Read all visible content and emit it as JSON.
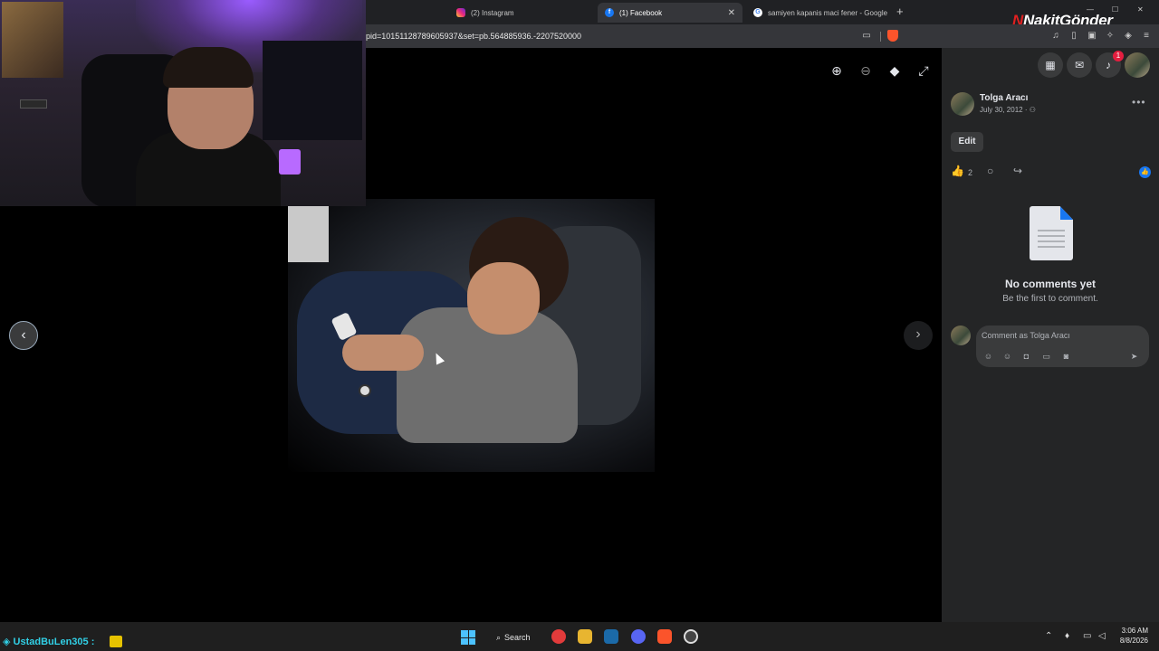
{
  "browser": {
    "tabs": [
      {
        "label": "(2) Instagram",
        "icon": "instagram-icon"
      },
      {
        "label": "(1) Facebook",
        "icon": "facebook-icon",
        "active": true
      },
      {
        "label": "samiyen kapanis maci fener - Google",
        "icon": "google-icon"
      }
    ],
    "new_tab": "+",
    "url": "pid=10151128789605937&set=pb.564885936.-2207520000",
    "brand_overlay": {
      "prefix": "N",
      "text": "NakitGönder"
    }
  },
  "viewer": {
    "tools": [
      "zoom-in-icon",
      "zoom-out-icon",
      "tag-icon",
      "fullscreen-icon"
    ],
    "prev_label": "‹",
    "next_label": "›"
  },
  "panel": {
    "top_buttons": [
      "apps-grid-icon",
      "messenger-icon",
      "notifications-icon",
      "account-avatar"
    ],
    "notification_count": "1",
    "post": {
      "author": "Tolga Aracı",
      "date": "July 30, 2012 ·",
      "privacy_icon": "friends-icon",
      "edit_label": "Edit",
      "like_count": "2"
    },
    "comments": {
      "empty_title": "No comments yet",
      "empty_subtitle": "Be the first to comment.",
      "input_placeholder": "Comment as Tolga Aracı"
    }
  },
  "overlay": {
    "chat_user": "UstadBuLen305 :"
  },
  "taskbar": {
    "search_label": "Search",
    "time": "3:06 AM",
    "date": "8/8/2026"
  },
  "colors": {
    "facebook_blue": "#1877f2",
    "panel_bg": "#242526",
    "chat_user": "#31d0e6",
    "notification_red": "#e41e3f"
  }
}
